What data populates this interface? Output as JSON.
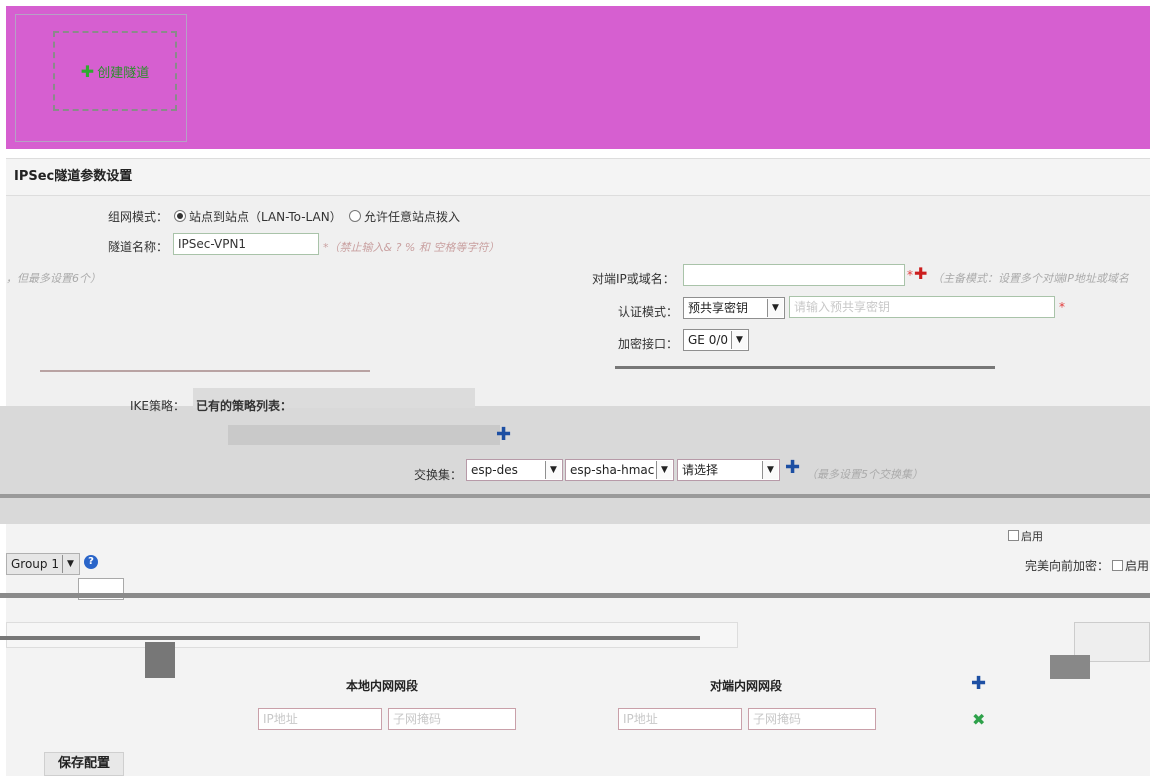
{
  "banner": {
    "create_label": "创建隧道",
    "create_icon": "plus-icon"
  },
  "section": {
    "title": "IPSec隧道参数设置"
  },
  "mode": {
    "label": "组网模式：",
    "option1": "站点到站点（LAN-To-LAN）",
    "option2": "允许任意站点拨入",
    "selected": "option1"
  },
  "tunnel_name": {
    "label": "隧道名称：",
    "value": "IPSec-VPN1",
    "hint": "*（禁止输入& ? % 和 空格等字符）"
  },
  "left_hint": "，但最多设置6个）",
  "peer": {
    "label": "对端IP或域名：",
    "value": "",
    "hint": "（主备模式：设置多个对端IP地址或域名"
  },
  "auth": {
    "label": "认证模式：",
    "selected": "预共享密钥",
    "key_placeholder": "请输入预共享密钥"
  },
  "iface": {
    "label": "加密接口：",
    "selected": "GE 0/0"
  },
  "ike": {
    "label": "IKE策略：",
    "value": "已有的策略列表："
  },
  "transform": {
    "label": "交换集：",
    "encryption": "esp-des",
    "hash": "esp-sha-hmac",
    "extra": "请选择",
    "hint": "（最多设置5个交换集）"
  },
  "group": {
    "selected": "Group 1"
  },
  "pfs": {
    "label": "完美向前加密：",
    "option": "启用"
  },
  "advanced": {
    "label": "启用",
    "enable_label": "启用"
  },
  "table": {
    "col_local": "本地内网网段",
    "col_remote": "对端内网网段",
    "ip_placeholder": "IP地址",
    "mask_placeholder": "子网掩码"
  },
  "save_label": "保存配置"
}
